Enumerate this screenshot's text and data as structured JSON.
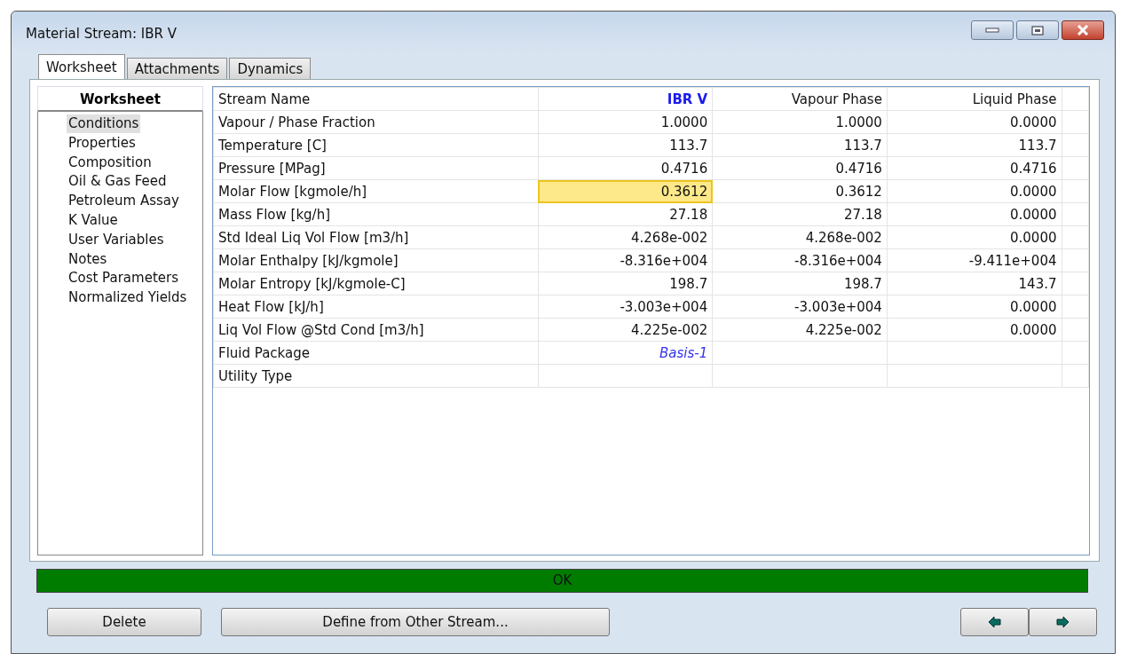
{
  "window": {
    "title": "Material Stream: IBR V"
  },
  "tabs": [
    {
      "label": "Worksheet",
      "selected": true
    },
    {
      "label": "Attachments",
      "selected": false
    },
    {
      "label": "Dynamics",
      "selected": false
    }
  ],
  "sidebar": {
    "heading": "Worksheet",
    "items": [
      {
        "label": "Conditions",
        "selected": true
      },
      {
        "label": "Properties",
        "selected": false
      },
      {
        "label": "Composition",
        "selected": false
      },
      {
        "label": "Oil & Gas Feed",
        "selected": false
      },
      {
        "label": "Petroleum Assay",
        "selected": false
      },
      {
        "label": "K Value",
        "selected": false
      },
      {
        "label": "User Variables",
        "selected": false
      },
      {
        "label": "Notes",
        "selected": false
      },
      {
        "label": "Cost Parameters",
        "selected": false
      },
      {
        "label": "Normalized Yields",
        "selected": false
      }
    ]
  },
  "table": {
    "columns": [
      {
        "label": "Stream Name",
        "kind": "label"
      },
      {
        "label": "IBR V",
        "kind": "stream"
      },
      {
        "label": "Vapour Phase",
        "kind": "phase"
      },
      {
        "label": "Liquid Phase",
        "kind": "phase"
      }
    ],
    "rows": [
      {
        "cells": [
          {
            "text": "Vapour / Phase Fraction",
            "kind": "label",
            "selected": false
          },
          {
            "text": "1.0000",
            "kind": "value",
            "selected": false
          },
          {
            "text": "1.0000",
            "kind": "value",
            "selected": false
          },
          {
            "text": "0.0000",
            "kind": "value",
            "selected": false
          }
        ]
      },
      {
        "cells": [
          {
            "text": "Temperature [C]",
            "kind": "label",
            "selected": false
          },
          {
            "text": "113.7",
            "kind": "value",
            "selected": false
          },
          {
            "text": "113.7",
            "kind": "value",
            "selected": false
          },
          {
            "text": "113.7",
            "kind": "value",
            "selected": false
          }
        ]
      },
      {
        "cells": [
          {
            "text": "Pressure [MPag]",
            "kind": "label",
            "selected": false
          },
          {
            "text": "0.4716",
            "kind": "value",
            "selected": false
          },
          {
            "text": "0.4716",
            "kind": "value",
            "selected": false
          },
          {
            "text": "0.4716",
            "kind": "value",
            "selected": false
          }
        ]
      },
      {
        "cells": [
          {
            "text": "Molar Flow [kgmole/h]",
            "kind": "label",
            "selected": false
          },
          {
            "text": "0.3612",
            "kind": "value",
            "selected": true
          },
          {
            "text": "0.3612",
            "kind": "value",
            "selected": false
          },
          {
            "text": "0.0000",
            "kind": "value",
            "selected": false
          }
        ]
      },
      {
        "cells": [
          {
            "text": "Mass Flow [kg/h]",
            "kind": "label",
            "selected": false
          },
          {
            "text": "27.18",
            "kind": "value",
            "selected": false
          },
          {
            "text": "27.18",
            "kind": "value",
            "selected": false
          },
          {
            "text": "0.0000",
            "kind": "value",
            "selected": false
          }
        ]
      },
      {
        "cells": [
          {
            "text": "Std Ideal Liq Vol Flow [m3/h]",
            "kind": "label",
            "selected": false
          },
          {
            "text": "4.268e-002",
            "kind": "value",
            "selected": false
          },
          {
            "text": "4.268e-002",
            "kind": "value",
            "selected": false
          },
          {
            "text": "0.0000",
            "kind": "value",
            "selected": false
          }
        ]
      },
      {
        "cells": [
          {
            "text": "Molar Enthalpy [kJ/kgmole]",
            "kind": "label",
            "selected": false
          },
          {
            "text": "-8.316e+004",
            "kind": "value",
            "selected": false
          },
          {
            "text": "-8.316e+004",
            "kind": "value",
            "selected": false
          },
          {
            "text": "-9.411e+004",
            "kind": "value",
            "selected": false
          }
        ]
      },
      {
        "cells": [
          {
            "text": "Molar Entropy [kJ/kgmole-C]",
            "kind": "label",
            "selected": false
          },
          {
            "text": "198.7",
            "kind": "value",
            "selected": false
          },
          {
            "text": "198.7",
            "kind": "value",
            "selected": false
          },
          {
            "text": "143.7",
            "kind": "value",
            "selected": false
          }
        ]
      },
      {
        "cells": [
          {
            "text": "Heat Flow [kJ/h]",
            "kind": "label",
            "selected": false
          },
          {
            "text": "-3.003e+004",
            "kind": "value",
            "selected": false
          },
          {
            "text": "-3.003e+004",
            "kind": "value",
            "selected": false
          },
          {
            "text": "0.0000",
            "kind": "value",
            "selected": false
          }
        ]
      },
      {
        "cells": [
          {
            "text": "Liq Vol Flow @Std Cond [m3/h]",
            "kind": "label",
            "selected": false
          },
          {
            "text": "4.225e-002",
            "kind": "value",
            "selected": false
          },
          {
            "text": "4.225e-002",
            "kind": "value",
            "selected": false
          },
          {
            "text": "0.0000",
            "kind": "value",
            "selected": false
          }
        ]
      },
      {
        "cells": [
          {
            "text": "Fluid Package",
            "kind": "label",
            "selected": false
          },
          {
            "text": "Basis-1",
            "kind": "link",
            "selected": false
          }
        ]
      },
      {
        "cells": [
          {
            "text": "Utility Type",
            "kind": "label",
            "selected": false
          }
        ]
      }
    ]
  },
  "status_bar": {
    "text": "OK"
  },
  "buttons": [
    {
      "label": "Delete"
    },
    {
      "label": "Define from Other Stream..."
    }
  ],
  "nav_buttons": [
    {
      "kind": "back"
    },
    {
      "kind": "forward"
    }
  ]
}
